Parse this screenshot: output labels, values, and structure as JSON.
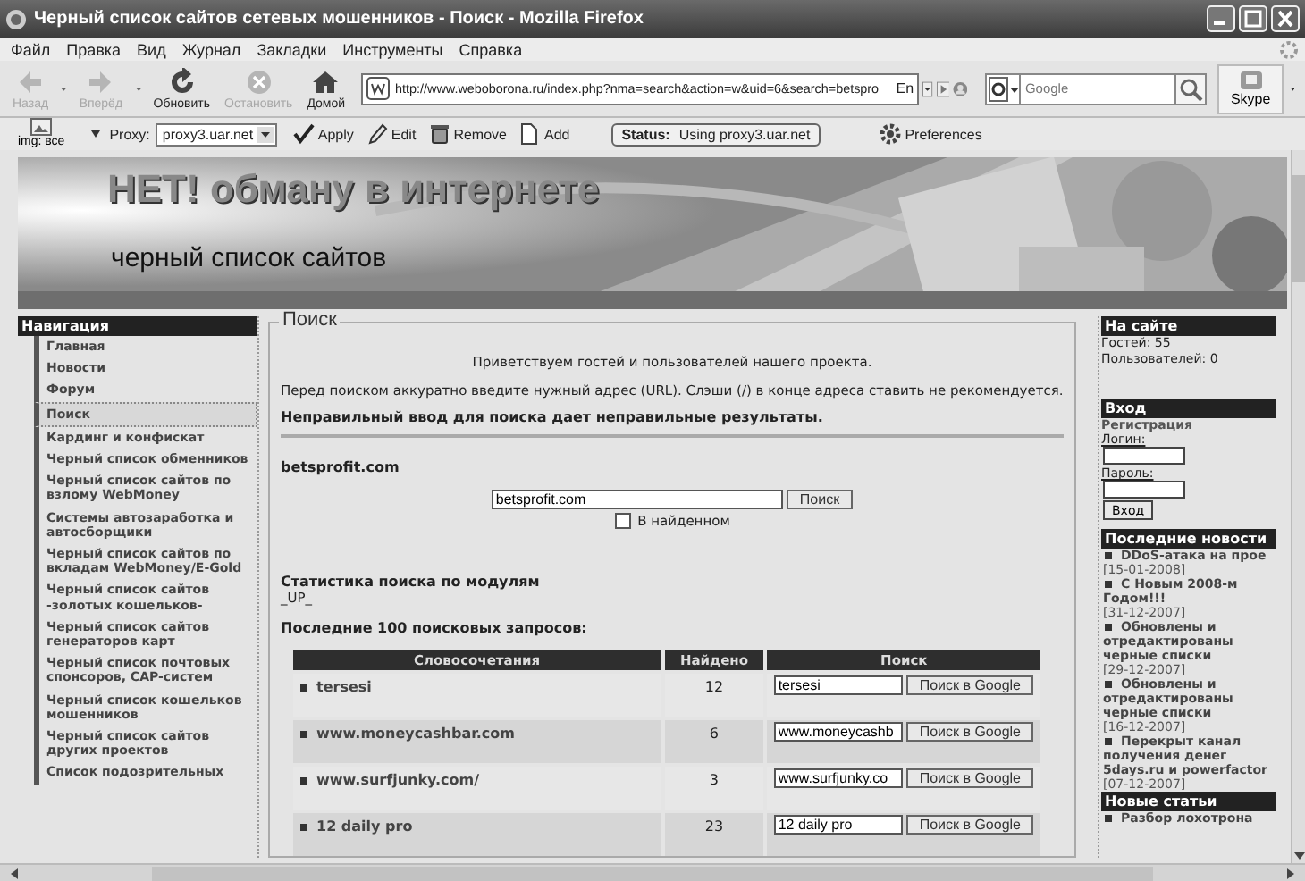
{
  "window": {
    "title": "Черный список сайтов сетевых мошенников - Поиск - Mozilla Firefox"
  },
  "menu": [
    "Файл",
    "Правка",
    "Вид",
    "Журнал",
    "Закладки",
    "Инструменты",
    "Справка"
  ],
  "nav_buttons": [
    {
      "label": "Назад",
      "disabled": true,
      "dropdown": true
    },
    {
      "label": "Вперёд",
      "disabled": true,
      "dropdown": true
    },
    {
      "label": "Обновить",
      "disabled": false,
      "dropdown": false
    },
    {
      "label": "Остановить",
      "disabled": true,
      "dropdown": false
    },
    {
      "label": "Домой",
      "disabled": false,
      "dropdown": false
    }
  ],
  "address": {
    "value": "http://www.weboborona.ru/index.php?nma=search&action=w&uid=6&search=betspro",
    "lang": "En"
  },
  "web_search": {
    "placeholder": "Google"
  },
  "skype": {
    "label": "Skype"
  },
  "proxy_bar": {
    "img_label": "img: все",
    "proxy_label": "Proxy:",
    "proxy_value": "proxy3.uar.net",
    "actions": [
      "Apply",
      "Edit",
      "Remove",
      "Add"
    ],
    "status_label": "Status:",
    "status_value": "Using proxy3.uar.net",
    "preferences": "Preferences"
  },
  "banner": {
    "title": "НЕТ! обману в интернете",
    "subtitle": "черный список сайтов"
  },
  "navigation": {
    "heading": "Навигация",
    "items": [
      {
        "label": "Главная",
        "selected": false
      },
      {
        "label": "Новости",
        "selected": false
      },
      {
        "label": "Форум",
        "selected": false
      },
      {
        "label": "Поиск",
        "selected": true
      },
      {
        "label": "Кардинг и конфискат",
        "selected": false
      },
      {
        "label": "Черный список обменников",
        "selected": false
      },
      {
        "label": "Черный список сайтов по взлому WebMoney",
        "selected": false
      },
      {
        "label": "Системы автозаработка и автосборщики",
        "selected": false
      },
      {
        "label": "Черный список сайтов по вкладам WebMoney/E-Gold",
        "selected": false
      },
      {
        "label": "Черный список сайтов -золотых кошельков-",
        "selected": false
      },
      {
        "label": "Черный список сайтов генераторов карт",
        "selected": false
      },
      {
        "label": "Черный список почтовых спонсоров, CAP-систем",
        "selected": false
      },
      {
        "label": "Черный список кошельков мошенников",
        "selected": false
      },
      {
        "label": "Черный список сайтов других проектов",
        "selected": false
      },
      {
        "label": "Список подозрительных",
        "selected": false
      }
    ]
  },
  "search_panel": {
    "legend": "Поиск",
    "welcome": "Приветствуем гостей и пользователей нашего проекта.",
    "note": "Перед поиском аккуратно введите нужный адрес (URL). Слэши (/) в конце адреса ставить не рекомендуется.",
    "warning": "Неправильный ввод для поиска дает неправильные результаты.",
    "query_heading": "betsprofit.com",
    "query_value": "betsprofit.com",
    "search_button": "Поиск",
    "in_found": {
      "label": "В найденном",
      "checked": false
    },
    "stats_heading": "Статистика поиска по модулям",
    "stats_module": "_UP_",
    "recent_heading": "Последние 100 поисковых запросов:",
    "table": {
      "columns": [
        "Словосочетания",
        "Найдено",
        "Поиск"
      ],
      "rows": [
        {
          "phrase": "tersesi",
          "found": "12",
          "field": "tersesi",
          "button": "Поиск в Google"
        },
        {
          "phrase": "www.moneycashbar.com",
          "found": "6",
          "field": "www.moneycashb",
          "button": "Поиск в Google"
        },
        {
          "phrase": "www.surfjunky.com/",
          "found": "3",
          "field": "www.surfjunky.co",
          "button": "Поиск в Google"
        },
        {
          "phrase": "12 daily pro",
          "found": "23",
          "field": "12 daily pro",
          "button": "Поиск в Google"
        }
      ]
    }
  },
  "on_site": {
    "heading": "На сайте",
    "lines": [
      "Гостей: 55",
      "Пользователей: 0"
    ]
  },
  "login": {
    "heading": "Вход",
    "register": "Регистрация",
    "login_label": "Логин:",
    "password_label": "Пароль:",
    "button": "Вход"
  },
  "news": {
    "heading": "Последние новости",
    "items": [
      {
        "title": "DDoS-атака на прое",
        "date": "[15-01-2008]"
      },
      {
        "title": "С Новым 2008-м Годом!!!",
        "date": "[31-12-2007]"
      },
      {
        "title": "Обновлены и отредактированы черные списки",
        "date": "[29-12-2007]"
      },
      {
        "title": "Обновлены и отредактированы черные списки",
        "date": "[16-12-2007]"
      },
      {
        "title": "Перекрыт канал получения денег 5days.ru и powerfactor",
        "date": "[07-12-2007]"
      }
    ]
  },
  "articles": {
    "heading": "Новые статьи",
    "items": [
      "Разбор лохотрона"
    ]
  }
}
